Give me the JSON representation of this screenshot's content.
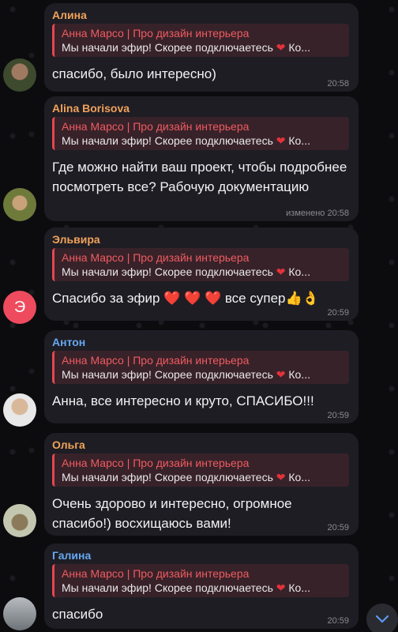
{
  "reply_quote": {
    "title": "Анна Марсо | Про дизайн интерьера",
    "text_before_icon": "Мы начали эфир! Скорее подключаетесь ",
    "icon": "heart-icon",
    "text_after_icon": " Ко..."
  },
  "colors": {
    "accent_red": "#e5474e",
    "bubble_bg": "#1e1d24",
    "name_alina": "#f0a25a",
    "name_alina_b": "#f0a25a",
    "name_elvira": "#f0a25a",
    "name_anton": "#66a8f0",
    "name_olga": "#f0a25a",
    "name_galina": "#66a8f0"
  },
  "messages": [
    {
      "sender": "Алина",
      "text": "спасибо, было интересно)",
      "time": "20:58",
      "avatar": "photo"
    },
    {
      "sender": "Alina Borisova",
      "text": "Где можно найти ваш проект, чтобы подробнее посмотреть все? Рабочую документацию",
      "time": "изменено 20:58",
      "avatar": "photo"
    },
    {
      "sender": "Эльвира",
      "text": "Спасибо за эфир",
      "emoji_suffix": "❤️ ❤️ ❤️  все супер👍👌",
      "time": "20:59",
      "avatar_letter": "Э"
    },
    {
      "sender": "Антон",
      "text": "Анна, все интересно и круто, СПАСИБО!!!",
      "time": "20:59",
      "avatar": "photo"
    },
    {
      "sender": "Ольга",
      "text": "Очень здорово и интересно, огромное спасибо!) восхищаюсь вами!",
      "time": "20:59",
      "avatar": "photo"
    },
    {
      "sender": "Галина",
      "text": "спасибо",
      "time": "20:59",
      "avatar": "photo"
    }
  ],
  "scroll_down": {
    "icon": "chevron-down-icon"
  }
}
